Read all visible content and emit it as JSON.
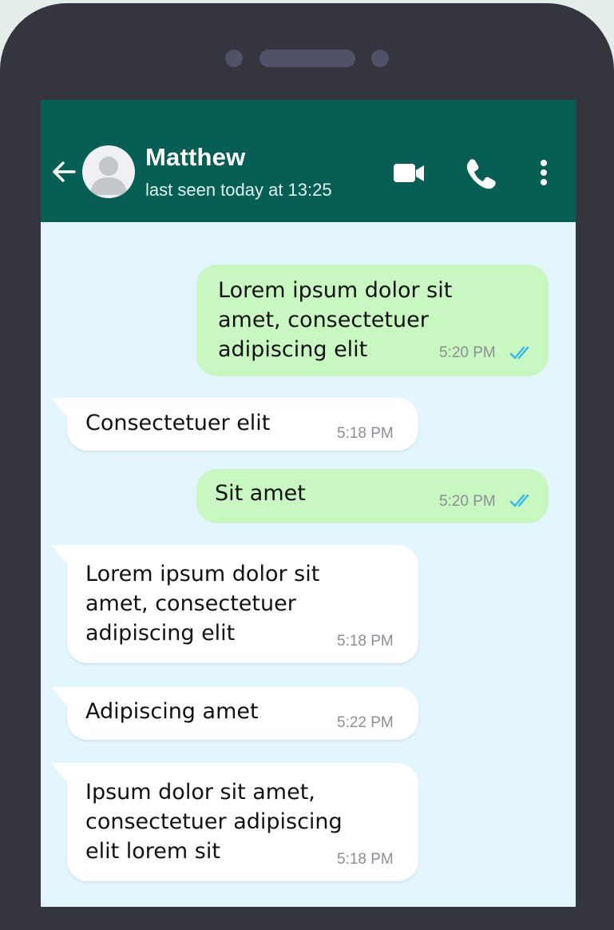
{
  "contact": {
    "name": "Matthew",
    "status": "last seen today at 13:25"
  },
  "icons": {
    "back": "arrow-left-icon",
    "avatar": "user-silhouette-icon",
    "video": "video-camera-icon",
    "call": "phone-icon",
    "more": "vertical-ellipsis-icon",
    "read": "double-check-icon"
  },
  "colors": {
    "header": "#075e54",
    "chat_background": "#e3f5fd",
    "outgoing_bubble": "#c9f7c2",
    "incoming_bubble": "#ffffff",
    "read_ticks": "#34b7f1"
  },
  "messages": [
    {
      "direction": "out",
      "text": "Lorem ipsum dolor sit\namet, consectetuer\nadipiscing elit",
      "time": "5:20 PM",
      "read": true
    },
    {
      "direction": "in",
      "text": "Consectetuer elit",
      "time": "5:18 PM"
    },
    {
      "direction": "out",
      "text": "Sit amet",
      "time": "5:20 PM",
      "read": true
    },
    {
      "direction": "in",
      "text": "Lorem ipsum dolor sit\namet, consectetuer\nadipiscing elit",
      "time": "5:18 PM"
    },
    {
      "direction": "in",
      "text": "Adipiscing amet",
      "time": "5:22 PM"
    },
    {
      "direction": "in",
      "text": "Ipsum dolor sit amet,\nconsectetuer adipiscing\nelit lorem sit",
      "time": "5:18 PM"
    }
  ]
}
